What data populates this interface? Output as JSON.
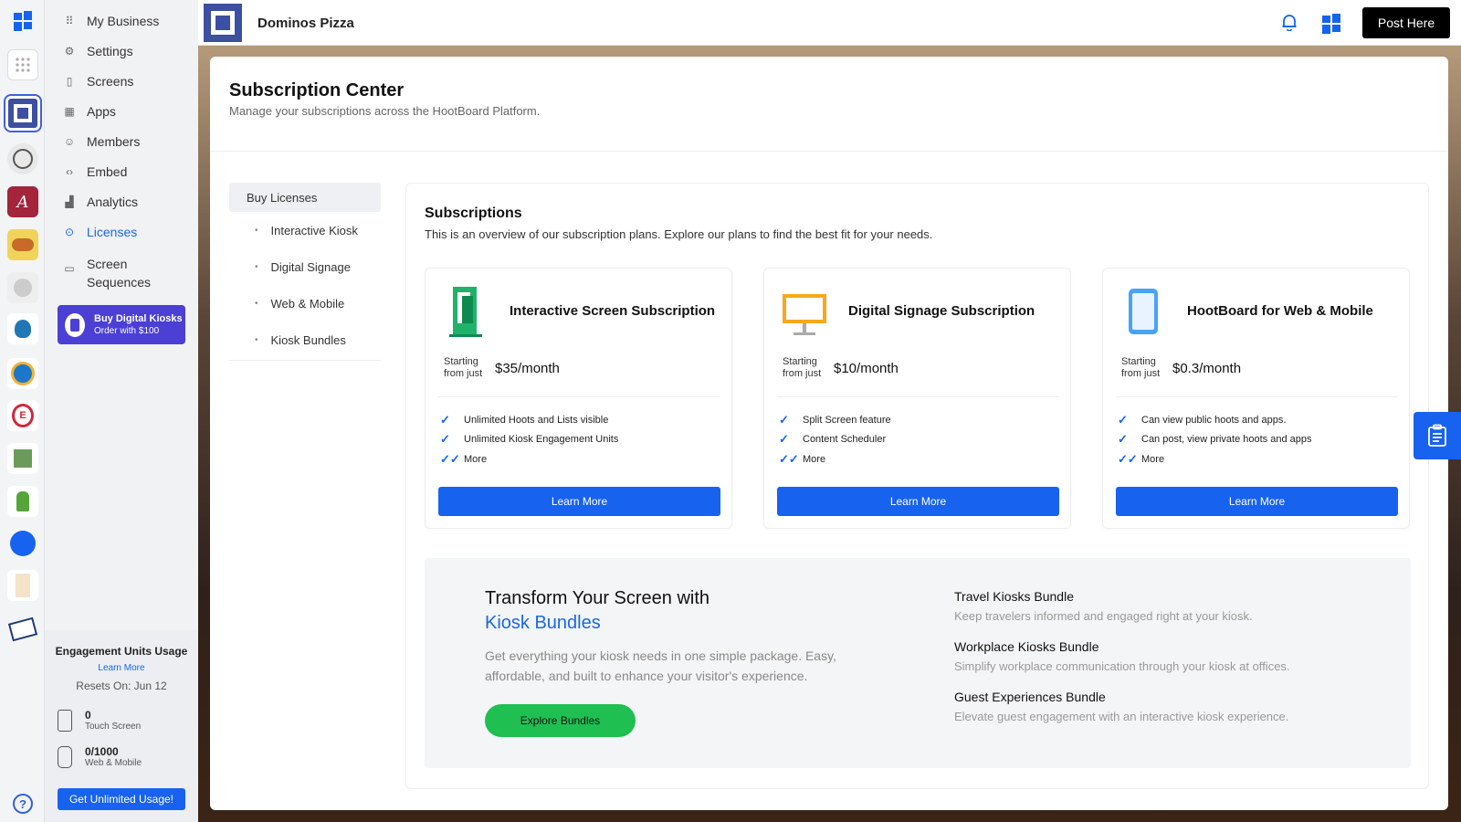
{
  "topbar": {
    "business_name": "Dominos Pizza",
    "post_button": "Post Here"
  },
  "sidebar": {
    "items": [
      {
        "label": "My Business",
        "icon": "grid-dots-icon"
      },
      {
        "label": "Settings",
        "icon": "gear-icon"
      },
      {
        "label": "Screens",
        "icon": "screen-icon"
      },
      {
        "label": "Apps",
        "icon": "apps-icon"
      },
      {
        "label": "Members",
        "icon": "person-icon"
      },
      {
        "label": "Embed",
        "icon": "code-icon"
      },
      {
        "label": "Analytics",
        "icon": "analytics-icon"
      },
      {
        "label": "Licenses",
        "icon": "license-icon",
        "active": true
      },
      {
        "label": "Screen Sequences",
        "icon": "sequence-icon"
      }
    ],
    "promo": {
      "line1": "Buy Digital Kiosks",
      "line2": "Order with $100"
    }
  },
  "usage": {
    "title": "Engagement Units Usage",
    "learn_more": "Learn More",
    "resets": "Resets On: Jun 12",
    "touch": {
      "value": "0",
      "label": "Touch Screen"
    },
    "web": {
      "value": "0/1000",
      "label": "Web & Mobile"
    },
    "cta": "Get Unlimited Usage!"
  },
  "page": {
    "title": "Subscription Center",
    "subtitle": "Manage your subscriptions across the HootBoard Platform."
  },
  "license_menu": {
    "header": "Buy Licenses",
    "items": [
      "Interactive Kiosk",
      "Digital Signage",
      "Web & Mobile",
      "Kiosk Bundles"
    ]
  },
  "subscriptions": {
    "title": "Subscriptions",
    "description": "This is an overview of our subscription plans. Explore our plans to find the best fit for your needs.",
    "starting_line1": "Starting",
    "starting_line2": "from just",
    "learn_more": "Learn More",
    "plans": [
      {
        "title": "Interactive Screen Subscription",
        "price": "$35/month",
        "features": [
          "Unlimited Hoots and Lists visible",
          "Unlimited Kiosk Engagement Units",
          "More"
        ]
      },
      {
        "title": "Digital Signage Subscription",
        "price": "$10/month",
        "features": [
          "Split Screen feature",
          "Content Scheduler",
          "More"
        ]
      },
      {
        "title": "HootBoard for Web & Mobile",
        "price": "$0.3/month",
        "features": [
          "Can view public hoots and apps.",
          "Can post, view private hoots and apps",
          "More"
        ]
      }
    ]
  },
  "bundles": {
    "heading_line1": "Transform Your Screen with",
    "heading_line2": "Kiosk Bundles",
    "description": "Get everything your kiosk needs in one simple package. Easy, affordable, and built to enhance your visitor's experience.",
    "button": "Explore Bundles",
    "items": [
      {
        "title": "Travel Kiosks Bundle",
        "desc": "Keep travelers informed and engaged right at your kiosk."
      },
      {
        "title": "Workplace Kiosks Bundle",
        "desc": "Simplify workplace communication through your kiosk at offices."
      },
      {
        "title": "Guest Experiences Bundle",
        "desc": "Elevate guest engagement with an interactive kiosk experience."
      }
    ]
  },
  "colors": {
    "accent": "#1763f0",
    "brand": "#3d4fa0",
    "green": "#1fbf52"
  }
}
